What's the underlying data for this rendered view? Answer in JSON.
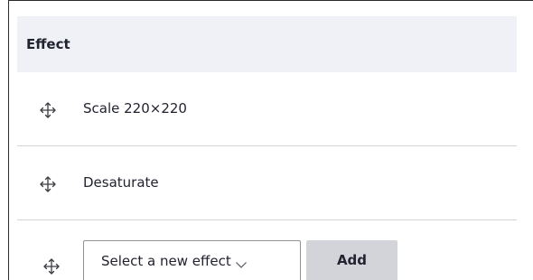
{
  "table": {
    "header": "Effect",
    "rows": [
      {
        "label": "Scale 220×220",
        "handle_icon": "move-arrows-icon"
      },
      {
        "label": "Desaturate",
        "handle_icon": "move-arrows-icon"
      }
    ]
  },
  "new_effect": {
    "select_value": "Select a new effect",
    "add_label": "Add",
    "handle_icon": "move-arrows-icon"
  }
}
